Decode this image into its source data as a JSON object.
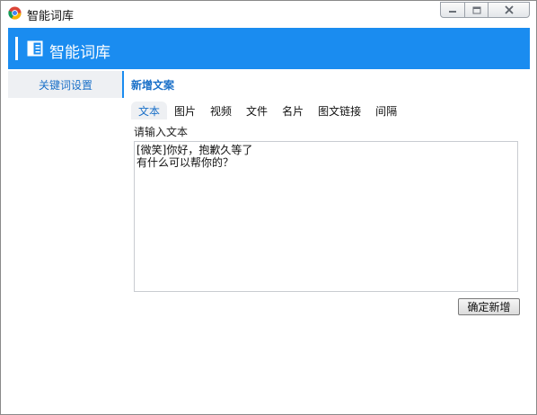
{
  "window": {
    "title": "智能词库"
  },
  "header": {
    "title": "智能词库",
    "accent_color": "#1a8cf0"
  },
  "sidebar": {
    "items": [
      {
        "label": "关键词设置",
        "selected": true
      }
    ]
  },
  "main": {
    "section_title": "新增文案",
    "tabs": [
      {
        "label": "文本",
        "active": true
      },
      {
        "label": "图片",
        "active": false
      },
      {
        "label": "视频",
        "active": false
      },
      {
        "label": "文件",
        "active": false
      },
      {
        "label": "名片",
        "active": false
      },
      {
        "label": "图文链接",
        "active": false
      },
      {
        "label": "间隔",
        "active": false
      }
    ],
    "field_label": "请输入文本",
    "text_value": "[微笑]你好，抱歉久等了\n有什么可以帮你的？",
    "confirm_label": "确定新增"
  }
}
